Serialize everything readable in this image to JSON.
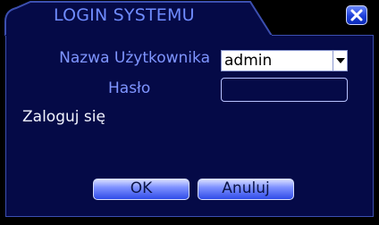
{
  "dialog": {
    "title": "LOGIN SYSTEMU",
    "close_icon": "close-icon",
    "username_label": "Nazwa Użytkownika",
    "username_value": "admin",
    "password_label": "Hasło",
    "password_value": "",
    "info_text": "Zaloguj się",
    "ok_label": "OK",
    "cancel_label": "Anuluj"
  },
  "colors": {
    "background": "#000000",
    "panel": "#050a47",
    "border": "#3c4fb0",
    "label": "#7f95ff",
    "button": "#2f4be8"
  }
}
